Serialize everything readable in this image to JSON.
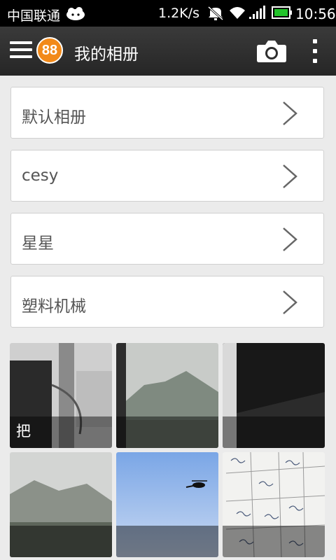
{
  "status_bar": {
    "carrier": "中国联通",
    "net_speed": "1.2K/s",
    "time": "10:56",
    "icons": [
      "message-cloud-icon",
      "muted-icon",
      "wifi-icon",
      "signal-icon",
      "battery-icon"
    ],
    "battery_color": "#22c32a"
  },
  "header": {
    "logo_text": "88",
    "title": "我的相册",
    "icons": [
      "menu-icon",
      "camera-icon",
      "more-vert-icon"
    ],
    "logo_color": "#f28a1a"
  },
  "albums": [
    {
      "label": "默认相册"
    },
    {
      "label": "cesy"
    },
    {
      "label": "星星"
    },
    {
      "label": "塑料机械"
    }
  ],
  "photos": [
    {
      "caption": "把"
    },
    {
      "caption": ""
    },
    {
      "caption": ""
    },
    {
      "caption": ""
    },
    {
      "caption": ""
    },
    {
      "caption": ""
    }
  ]
}
